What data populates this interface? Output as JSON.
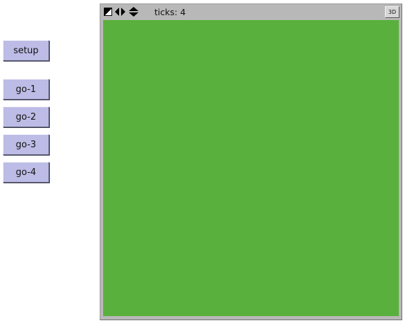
{
  "buttons": {
    "setup": "setup",
    "go1": "go-1",
    "go2": "go-2",
    "go3": "go-3",
    "go4": "go-4"
  },
  "view": {
    "ticks_label": "ticks: ",
    "ticks_value": "4",
    "three_d_label": "3D",
    "icons": [
      "shape-toggle-icon",
      "horizontal-arrows-icon",
      "vertical-arrows-icon"
    ]
  },
  "colors": {
    "button_bg": "#bcbce6",
    "world_bg": "#59b03c",
    "toolbar_bg": "#b8b8b8"
  }
}
